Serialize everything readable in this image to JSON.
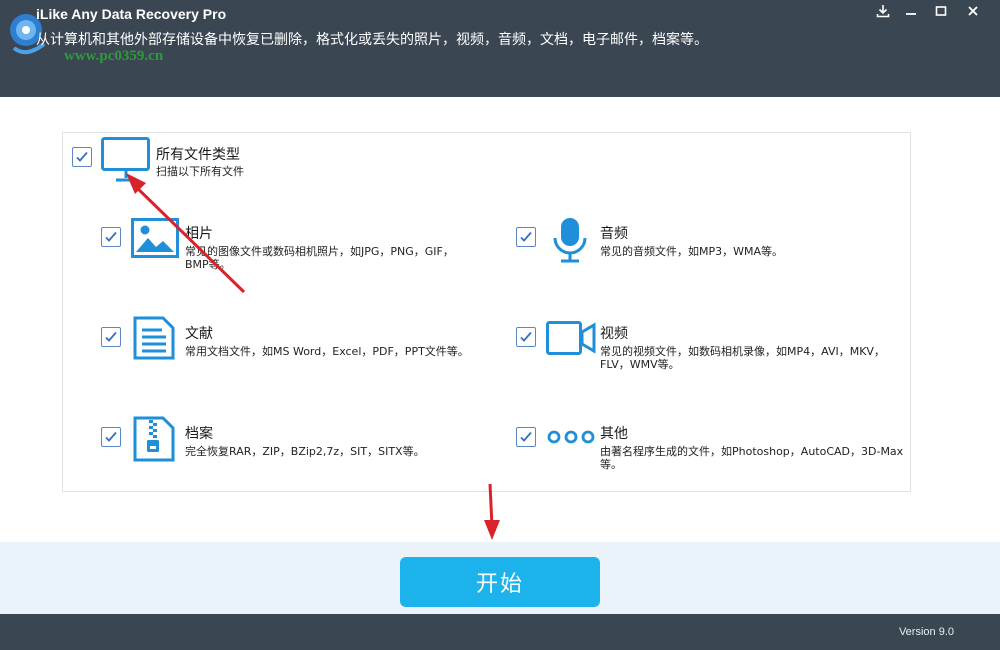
{
  "window": {
    "title": "iLike Any Data Recovery Pro",
    "subtitle": "从计算机和其他外部存储设备中恢复已删除，格式化或丢失的照片，视频，音频，文档，电子邮件，档案等。",
    "watermark": "www.pc0359.cn"
  },
  "all_types": {
    "title": "所有文件类型",
    "desc": "扫描以下所有文件",
    "checked": true
  },
  "categories": [
    {
      "title": "相片",
      "desc": "常见的图像文件或数码相机照片，如JPG，PNG，GIF，BMP等。",
      "icon": "image-icon",
      "checked": true
    },
    {
      "title": "音频",
      "desc": "常见的音频文件，如MP3，WMA等。",
      "icon": "microphone-icon",
      "checked": true
    },
    {
      "title": "文献",
      "desc": "常用文档文件，如MS Word，Excel，PDF，PPT文件等。",
      "icon": "document-icon",
      "checked": true
    },
    {
      "title": "视频",
      "desc": "常见的视频文件，如数码相机录像，如MP4，AVI，MKV，FLV，WMV等。",
      "icon": "video-camera-icon",
      "checked": true
    },
    {
      "title": "档案",
      "desc": "完全恢复RAR，ZIP，BZip2,7z，SIT，SITX等。",
      "icon": "zip-archive-icon",
      "checked": true
    },
    {
      "title": "其他",
      "desc": "由著名程序生成的文件，如Photoshop，AutoCAD，3D-Max等。",
      "icon": "more-dots-icon",
      "checked": true
    }
  ],
  "start_label": "开始",
  "version": "Version 9.0",
  "colors": {
    "header_bg": "#3a4652",
    "accent": "#1cb3ec",
    "icon_blue": "#1e8fd8",
    "annotation_red": "#d8232a"
  }
}
